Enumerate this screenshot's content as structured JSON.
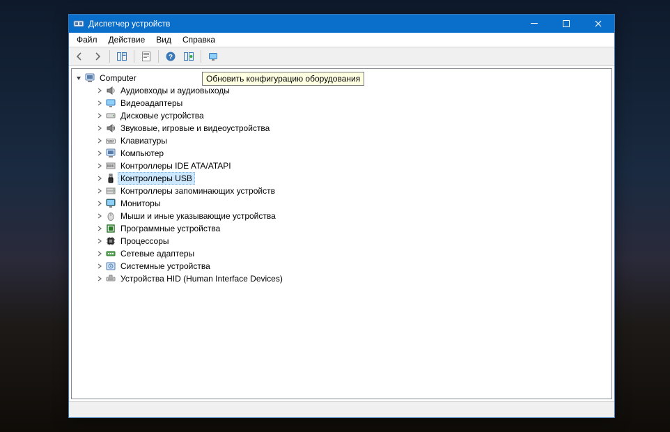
{
  "window": {
    "title": "Диспетчер устройств"
  },
  "menu": {
    "file": "Файл",
    "action": "Действие",
    "view": "Вид",
    "help": "Справка"
  },
  "tooltip": "Обновить конфигурацию оборудования",
  "tree": {
    "root": "Computer",
    "items": [
      {
        "label": "Аудиовходы и аудиовыходы",
        "icon": "audio"
      },
      {
        "label": "Видеоадаптеры",
        "icon": "display"
      },
      {
        "label": "Дисковые устройства",
        "icon": "disk"
      },
      {
        "label": "Звуковые, игровые и видеоустройства",
        "icon": "sound"
      },
      {
        "label": "Клавиатуры",
        "icon": "keyboard"
      },
      {
        "label": "Компьютер",
        "icon": "computer"
      },
      {
        "label": "Контроллеры IDE ATA/ATAPI",
        "icon": "ide"
      },
      {
        "label": "Контроллеры USB",
        "icon": "usb",
        "selected": true
      },
      {
        "label": "Контроллеры запоминающих устройств",
        "icon": "storage"
      },
      {
        "label": "Мониторы",
        "icon": "monitor"
      },
      {
        "label": "Мыши и иные указывающие устройства",
        "icon": "mouse"
      },
      {
        "label": "Программные устройства",
        "icon": "software"
      },
      {
        "label": "Процессоры",
        "icon": "cpu"
      },
      {
        "label": "Сетевые адаптеры",
        "icon": "network"
      },
      {
        "label": "Системные устройства",
        "icon": "system"
      },
      {
        "label": "Устройства HID (Human Interface Devices)",
        "icon": "hid"
      }
    ]
  }
}
